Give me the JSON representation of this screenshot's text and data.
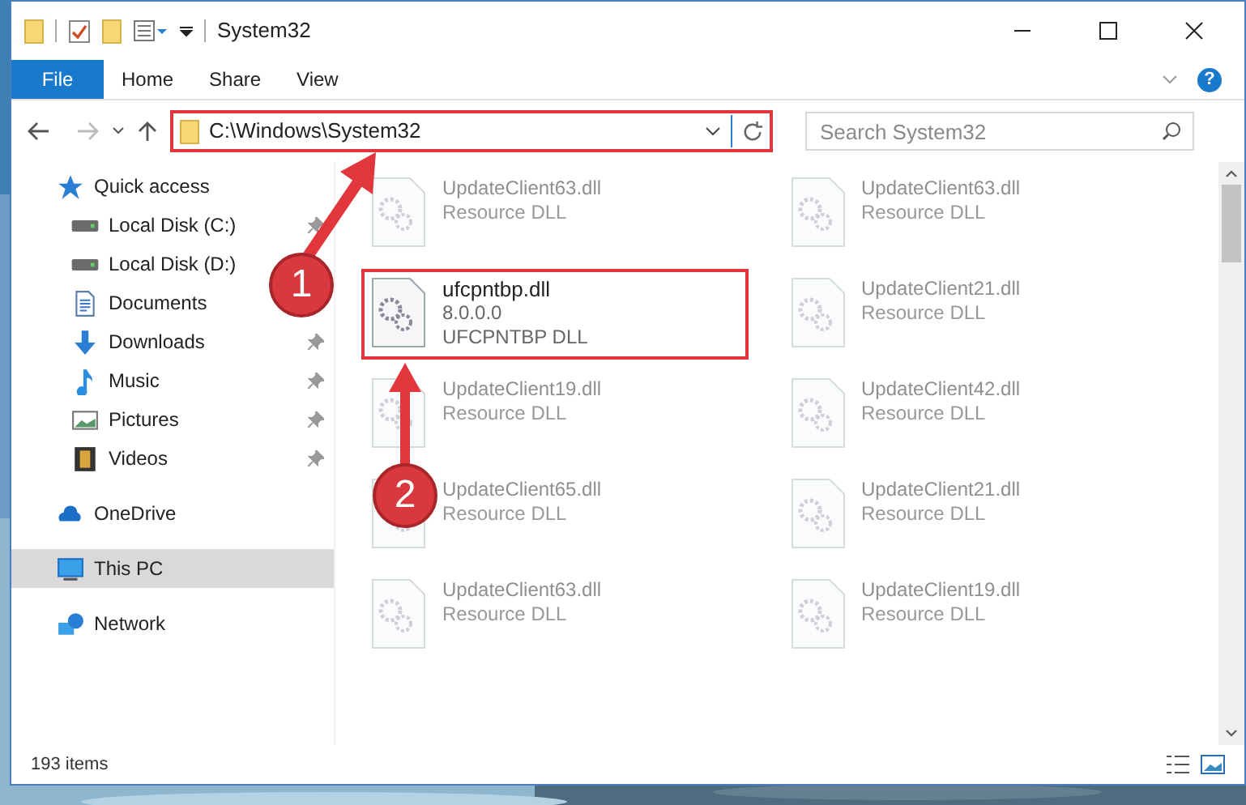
{
  "window": {
    "title": "System32"
  },
  "ribbon": {
    "tabs": [
      {
        "label": "File",
        "kind": "file"
      },
      {
        "label": "Home",
        "kind": "tab"
      },
      {
        "label": "Share",
        "kind": "tab"
      },
      {
        "label": "View",
        "kind": "tab"
      }
    ]
  },
  "address": {
    "path": "C:\\Windows\\System32"
  },
  "search": {
    "placeholder": "Search System32"
  },
  "help": {
    "label": "?"
  },
  "sidebar": {
    "items": [
      {
        "label": "Quick access",
        "kind": "star",
        "selected": false,
        "children": [
          {
            "label": "Local Disk (C:)",
            "kind": "drive",
            "pinned": true
          },
          {
            "label": "Local Disk (D:)",
            "kind": "drive",
            "pinned": false
          },
          {
            "label": "Documents",
            "kind": "document",
            "pinned": false
          },
          {
            "label": "Downloads",
            "kind": "download",
            "pinned": true
          },
          {
            "label": "Music",
            "kind": "music",
            "pinned": true
          },
          {
            "label": "Pictures",
            "pinned": true
          },
          {
            "label": "Videos",
            "kind": "film",
            "pinned": true
          }
        ]
      },
      {
        "label": "OneDrive",
        "kind": "cloud",
        "selected": false
      },
      {
        "label": "This PC",
        "kind": "monitor",
        "selected": true
      },
      {
        "label": "Network",
        "kind": "network",
        "selected": false
      }
    ]
  },
  "files": [
    {
      "name": "UpdateClient63.dll",
      "lines": [
        "Resource DLL"
      ],
      "faded": true,
      "highlighted": false
    },
    {
      "name": "UpdateClient63.dll",
      "lines": [
        "Resource DLL"
      ],
      "faded": true,
      "highlighted": false
    },
    {
      "name": "ufcpntbp.dll",
      "lines": [
        "8.0.0.0",
        "UFCPNTBP DLL"
      ],
      "faded": false,
      "highlighted": true
    },
    {
      "name": "UpdateClient21.dll",
      "lines": [
        "Resource DLL"
      ],
      "faded": true,
      "highlighted": false
    },
    {
      "name": "UpdateClient19.dll",
      "lines": [
        "Resource DLL"
      ],
      "faded": true,
      "highlighted": false
    },
    {
      "name": "UpdateClient42.dll",
      "lines": [
        "Resource DLL"
      ],
      "faded": true,
      "highlighted": false
    },
    {
      "name": "UpdateClient65.dll",
      "lines": [
        "Resource DLL"
      ],
      "faded": true,
      "highlighted": false
    },
    {
      "name": "UpdateClient21.dll",
      "lines": [
        "Resource DLL"
      ],
      "faded": true,
      "highlighted": false
    },
    {
      "name": "UpdateClient63.dll",
      "lines": [
        "Resource DLL"
      ],
      "faded": true,
      "highlighted": false
    },
    {
      "name": "UpdateClient19.dll",
      "lines": [
        "Resource DLL"
      ],
      "faded": true,
      "highlighted": false
    }
  ],
  "annotations": [
    {
      "number": "1"
    },
    {
      "number": "2"
    }
  ],
  "status_bar": {
    "count": "193 items"
  }
}
